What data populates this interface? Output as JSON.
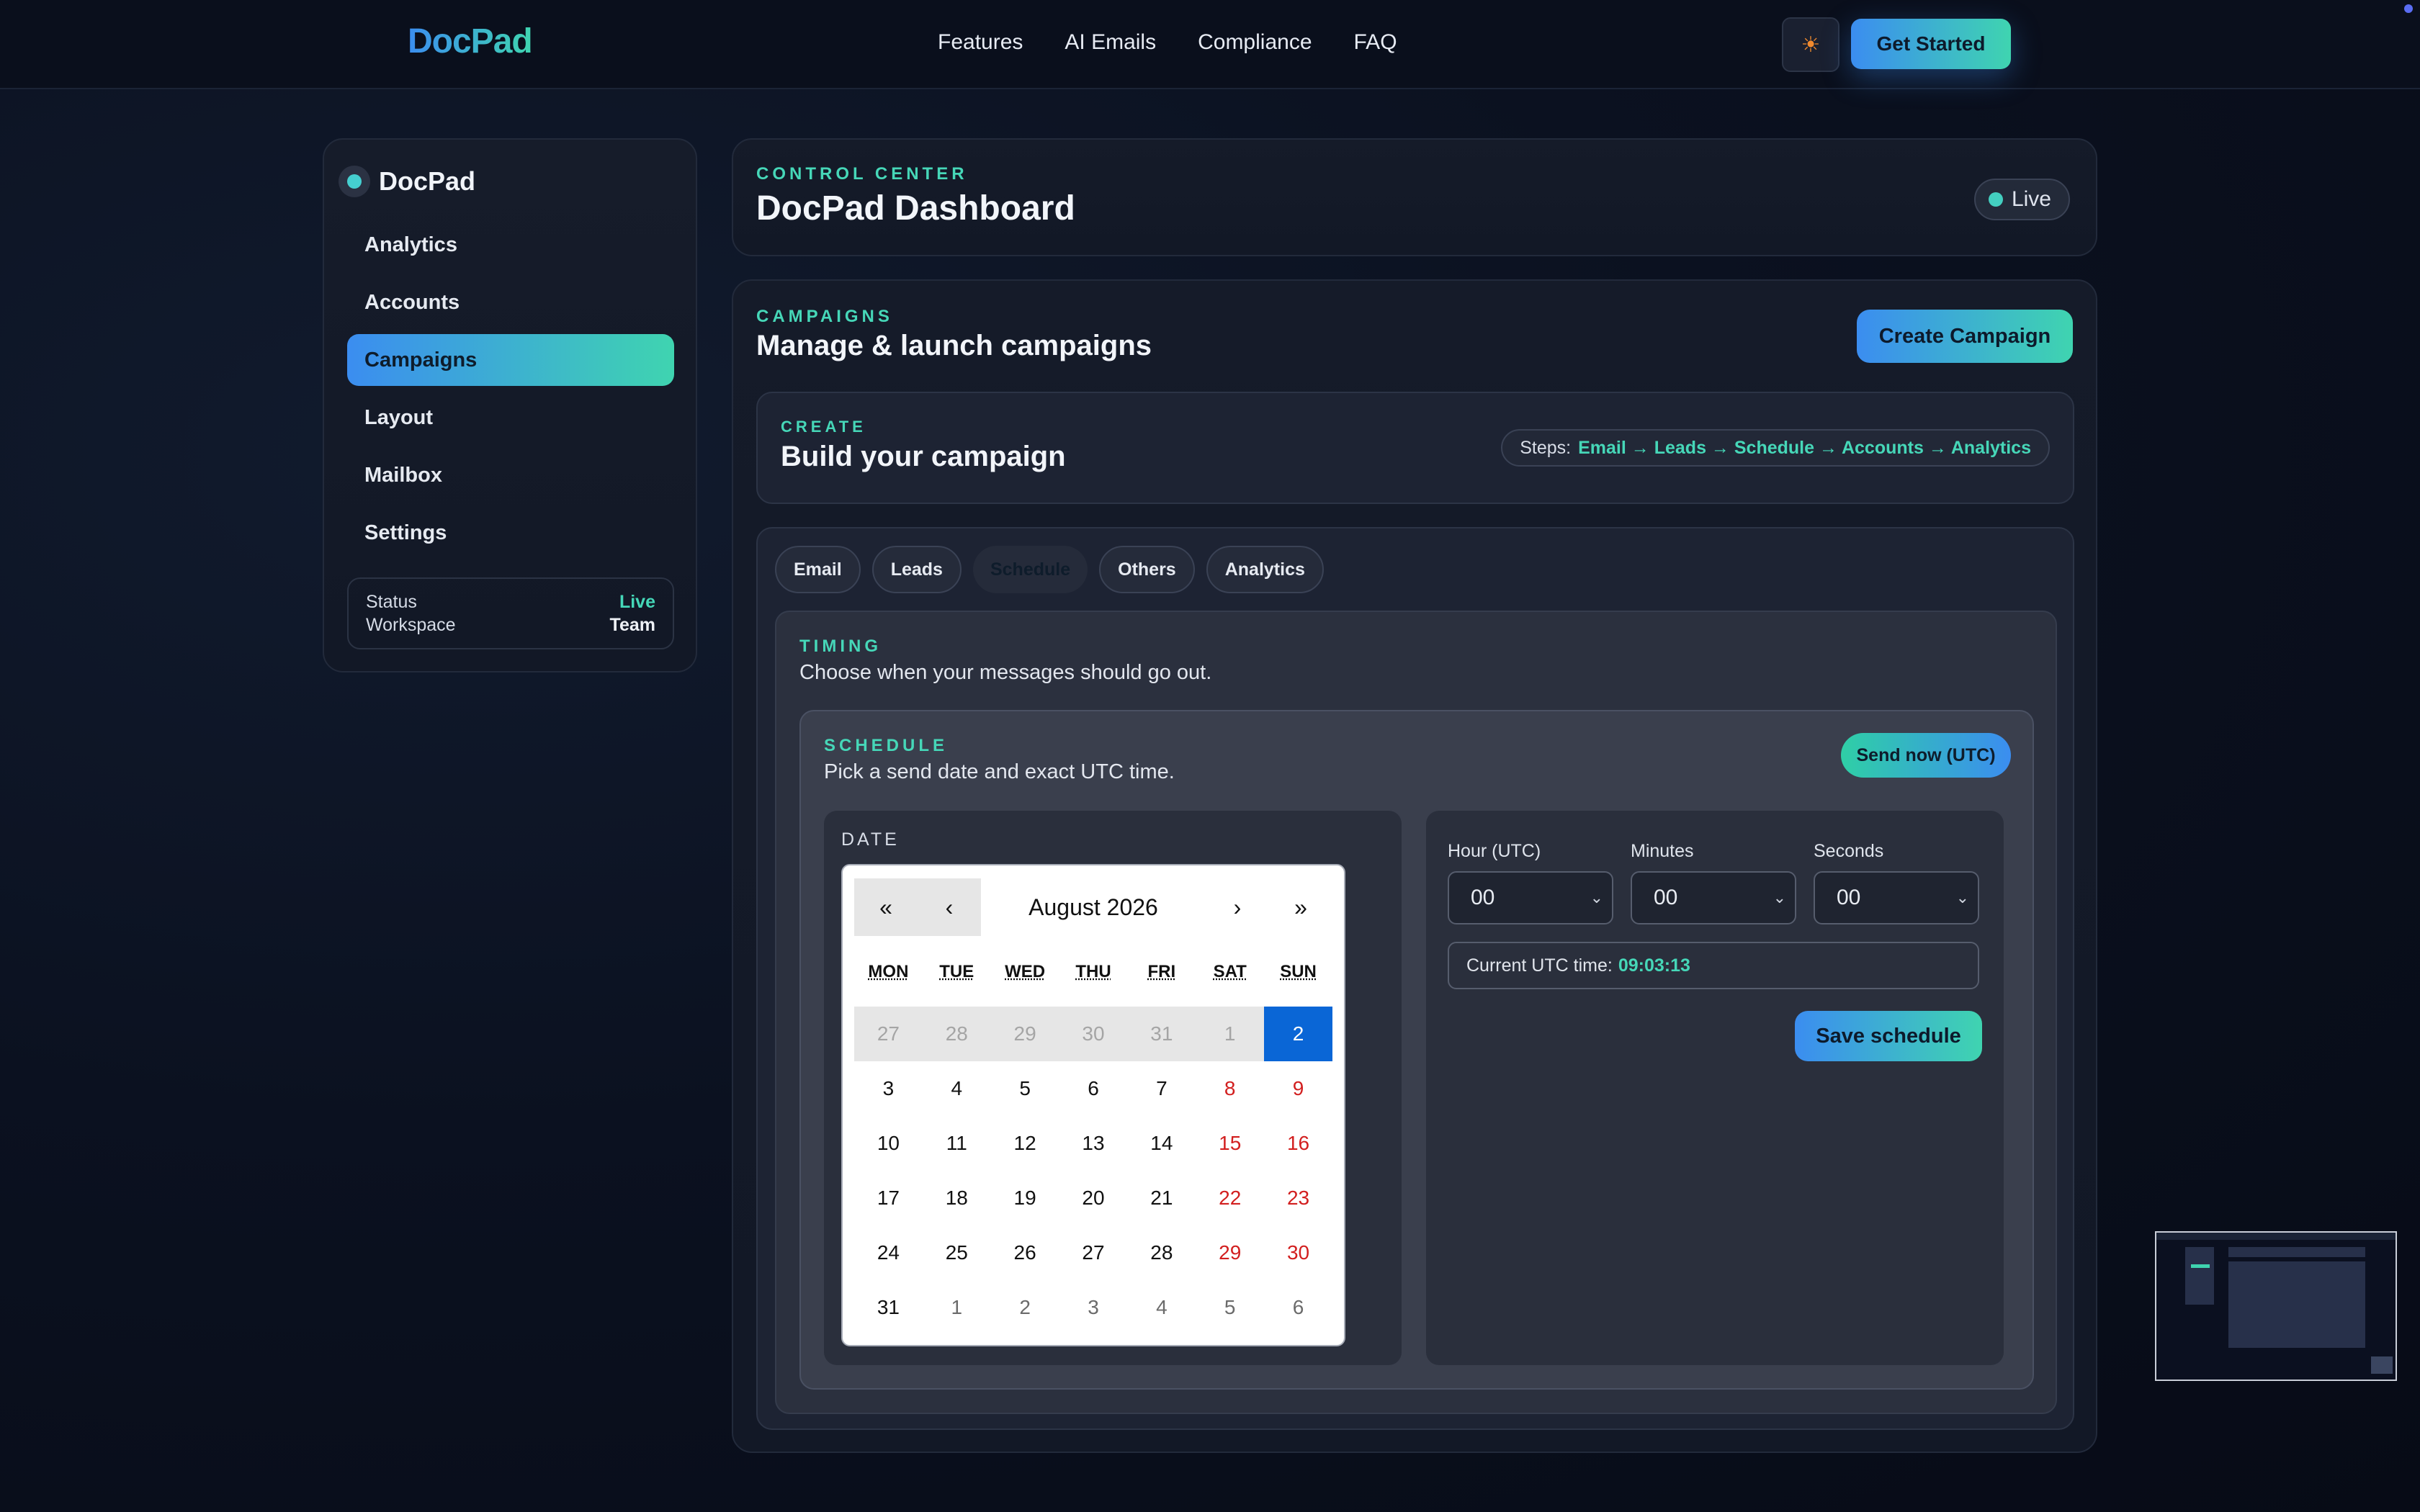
{
  "nav": {
    "brand": "DocPad",
    "links": [
      "Features",
      "AI Emails",
      "Compliance",
      "FAQ"
    ],
    "theme_icon": "sun-icon",
    "cta": "Get Started"
  },
  "sidebar": {
    "brand": "DocPad",
    "items": [
      {
        "label": "Analytics",
        "active": false
      },
      {
        "label": "Accounts",
        "active": false
      },
      {
        "label": "Campaigns",
        "active": true
      },
      {
        "label": "Layout",
        "active": false
      },
      {
        "label": "Mailbox",
        "active": false
      },
      {
        "label": "Settings",
        "active": false
      }
    ],
    "status": {
      "label1": "Status",
      "value1": "Live",
      "label2": "Workspace",
      "value2": "Team"
    }
  },
  "header": {
    "eyebrow": "CONTROL CENTER",
    "title": "DocPad Dashboard",
    "live": "Live"
  },
  "campaigns": {
    "eyebrow": "CAMPAIGNS",
    "title": "Manage & launch campaigns",
    "create_button": "Create Campaign",
    "create": {
      "eyebrow": "CREATE",
      "title": "Build your campaign",
      "steps_label": "Steps:",
      "steps_flow": "Email → Leads → Schedule → Accounts → Analytics"
    },
    "tabs": [
      {
        "label": "Email",
        "active": false
      },
      {
        "label": "Leads",
        "active": false
      },
      {
        "label": "Schedule",
        "active": true
      },
      {
        "label": "Others",
        "active": false
      },
      {
        "label": "Analytics",
        "active": false
      }
    ]
  },
  "timing": {
    "eyebrow": "TIMING",
    "desc": "Choose when your messages should go out.",
    "schedule": {
      "eyebrow": "SCHEDULE",
      "desc": "Pick a send date and exact UTC time.",
      "send_now": "Send now (UTC)",
      "date_label": "DATE",
      "calendar": {
        "nav": {
          "prev_year": "«",
          "prev_month": "‹",
          "next_month": "›",
          "next_year": "»"
        },
        "month_label": "August 2026",
        "weekdays": [
          "MON",
          "TUE",
          "WED",
          "THU",
          "FRI",
          "SAT",
          "SUN"
        ],
        "days": [
          [
            "27",
            "prev"
          ],
          [
            "28",
            "prev"
          ],
          [
            "29",
            "prev"
          ],
          [
            "30",
            "prev"
          ],
          [
            "31",
            "prev"
          ],
          [
            "1",
            "prev"
          ],
          [
            "2",
            "sel"
          ],
          [
            "3",
            ""
          ],
          [
            "4",
            ""
          ],
          [
            "5",
            ""
          ],
          [
            "6",
            ""
          ],
          [
            "7",
            ""
          ],
          [
            "8",
            "wk"
          ],
          [
            "9",
            "wk"
          ],
          [
            "10",
            ""
          ],
          [
            "11",
            ""
          ],
          [
            "12",
            ""
          ],
          [
            "13",
            ""
          ],
          [
            "14",
            ""
          ],
          [
            "15",
            "wk"
          ],
          [
            "16",
            "wk"
          ],
          [
            "17",
            ""
          ],
          [
            "18",
            ""
          ],
          [
            "19",
            ""
          ],
          [
            "20",
            ""
          ],
          [
            "21",
            ""
          ],
          [
            "22",
            "wk"
          ],
          [
            "23",
            "wk"
          ],
          [
            "24",
            ""
          ],
          [
            "25",
            ""
          ],
          [
            "26",
            ""
          ],
          [
            "27",
            ""
          ],
          [
            "28",
            ""
          ],
          [
            "29",
            "wk"
          ],
          [
            "30",
            "wk"
          ],
          [
            "31",
            ""
          ],
          [
            "1",
            "next"
          ],
          [
            "2",
            "next"
          ],
          [
            "3",
            "next"
          ],
          [
            "4",
            "next"
          ],
          [
            "5",
            "next"
          ],
          [
            "6",
            "next"
          ]
        ]
      },
      "time": {
        "hour_label": "Hour (UTC)",
        "hour_value": "00",
        "minutes_label": "Minutes",
        "minutes_value": "00",
        "seconds_label": "Seconds",
        "seconds_value": "00",
        "current_label": "Current UTC time:",
        "current_value": "09:03:13",
        "save": "Save schedule"
      }
    }
  },
  "colors": {
    "accent_start": "#3b8df0",
    "accent_end": "#3fd4b0",
    "selected_day": "#0a66d6",
    "weekend": "#d21f1f"
  }
}
